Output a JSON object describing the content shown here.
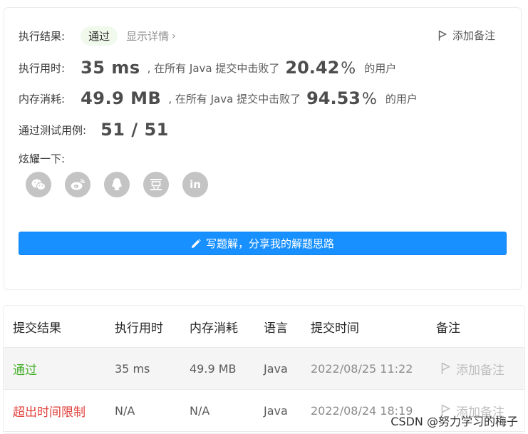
{
  "result": {
    "label": "执行结果:",
    "status": "通过",
    "detail_link": "显示详情",
    "add_note": "添加备注"
  },
  "runtime": {
    "label": "执行用时:",
    "value": "35 ms",
    "middle": ", 在所有 Java 提交中击败了",
    "percent": "20.42",
    "suffix": "的用户"
  },
  "memory": {
    "label": "内存消耗:",
    "value": "49.9 MB",
    "middle": ", 在所有 Java 提交中击败了",
    "percent": "94.53",
    "suffix": "的用户"
  },
  "testcases": {
    "label": "通过测试用例:",
    "value": "51 / 51"
  },
  "share": {
    "label": "炫耀一下:",
    "icons": [
      "wechat-icon",
      "weibo-icon",
      "qq-icon",
      "douban-icon",
      "linkedin-icon"
    ]
  },
  "solution_button": "写题解，分享我的解题思路",
  "table": {
    "headers": [
      "提交结果",
      "执行用时",
      "内存消耗",
      "语言",
      "提交时间",
      "备注"
    ],
    "rows": [
      {
        "status": "通过",
        "runtime": "35 ms",
        "memory": "49.9 MB",
        "lang": "Java",
        "time": "2022/08/25 11:22",
        "note": "添加备注"
      },
      {
        "status": "超出时间限制",
        "runtime": "N/A",
        "memory": "N/A",
        "lang": "Java",
        "time": "2022/08/24 18:19",
        "note": "添加备注"
      }
    ]
  },
  "watermark": "CSDN @努力学习的梅子",
  "colors": {
    "accent": "#1890ff",
    "pass": "#47b02c",
    "fail": "#e0413b"
  }
}
